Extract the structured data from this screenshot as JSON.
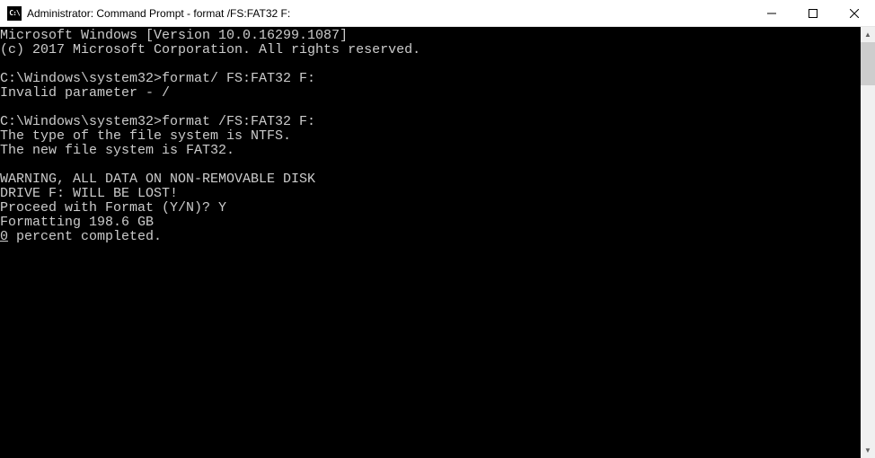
{
  "window": {
    "icon_label": "C:\\",
    "title": "Administrator: Command Prompt - format  /FS:FAT32 F:"
  },
  "controls": {
    "minimize": "minimize",
    "maximize": "maximize",
    "close": "close"
  },
  "console": {
    "lines": [
      "Microsoft Windows [Version 10.0.16299.1087]",
      "(c) 2017 Microsoft Corporation. All rights reserved.",
      "",
      "C:\\Windows\\system32>format/ FS:FAT32 F:",
      "Invalid parameter - /",
      "",
      "C:\\Windows\\system32>format /FS:FAT32 F:",
      "The type of the file system is NTFS.",
      "The new file system is FAT32.",
      "",
      "WARNING, ALL DATA ON NON-REMOVABLE DISK",
      "DRIVE F: WILL BE LOST!",
      "Proceed with Format (Y/N)? Y",
      "Formatting 198.6 GB",
      "0 percent completed."
    ],
    "cursor_line_index": 14,
    "cursor_char_index": 0
  },
  "scrollbar": {
    "up_arrow": "▲",
    "down_arrow": "▼"
  }
}
